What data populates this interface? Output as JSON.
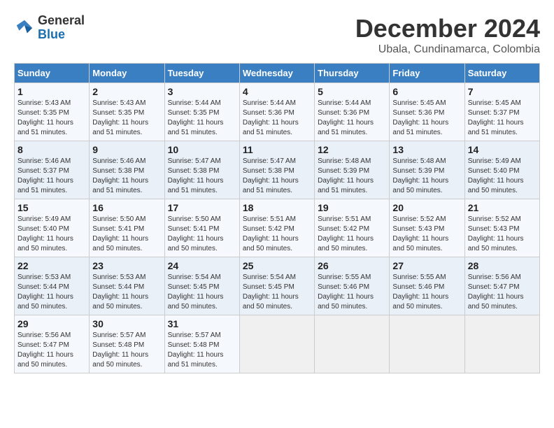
{
  "logo": {
    "line1": "General",
    "line2": "Blue"
  },
  "title": "December 2024",
  "subtitle": "Ubala, Cundinamarca, Colombia",
  "days_header": [
    "Sunday",
    "Monday",
    "Tuesday",
    "Wednesday",
    "Thursday",
    "Friday",
    "Saturday"
  ],
  "weeks": [
    [
      {
        "day": "1",
        "info": "Sunrise: 5:43 AM\nSunset: 5:35 PM\nDaylight: 11 hours\nand 51 minutes."
      },
      {
        "day": "2",
        "info": "Sunrise: 5:43 AM\nSunset: 5:35 PM\nDaylight: 11 hours\nand 51 minutes."
      },
      {
        "day": "3",
        "info": "Sunrise: 5:44 AM\nSunset: 5:35 PM\nDaylight: 11 hours\nand 51 minutes."
      },
      {
        "day": "4",
        "info": "Sunrise: 5:44 AM\nSunset: 5:36 PM\nDaylight: 11 hours\nand 51 minutes."
      },
      {
        "day": "5",
        "info": "Sunrise: 5:44 AM\nSunset: 5:36 PM\nDaylight: 11 hours\nand 51 minutes."
      },
      {
        "day": "6",
        "info": "Sunrise: 5:45 AM\nSunset: 5:36 PM\nDaylight: 11 hours\nand 51 minutes."
      },
      {
        "day": "7",
        "info": "Sunrise: 5:45 AM\nSunset: 5:37 PM\nDaylight: 11 hours\nand 51 minutes."
      }
    ],
    [
      {
        "day": "8",
        "info": "Sunrise: 5:46 AM\nSunset: 5:37 PM\nDaylight: 11 hours\nand 51 minutes."
      },
      {
        "day": "9",
        "info": "Sunrise: 5:46 AM\nSunset: 5:38 PM\nDaylight: 11 hours\nand 51 minutes."
      },
      {
        "day": "10",
        "info": "Sunrise: 5:47 AM\nSunset: 5:38 PM\nDaylight: 11 hours\nand 51 minutes."
      },
      {
        "day": "11",
        "info": "Sunrise: 5:47 AM\nSunset: 5:38 PM\nDaylight: 11 hours\nand 51 minutes."
      },
      {
        "day": "12",
        "info": "Sunrise: 5:48 AM\nSunset: 5:39 PM\nDaylight: 11 hours\nand 51 minutes."
      },
      {
        "day": "13",
        "info": "Sunrise: 5:48 AM\nSunset: 5:39 PM\nDaylight: 11 hours\nand 50 minutes."
      },
      {
        "day": "14",
        "info": "Sunrise: 5:49 AM\nSunset: 5:40 PM\nDaylight: 11 hours\nand 50 minutes."
      }
    ],
    [
      {
        "day": "15",
        "info": "Sunrise: 5:49 AM\nSunset: 5:40 PM\nDaylight: 11 hours\nand 50 minutes."
      },
      {
        "day": "16",
        "info": "Sunrise: 5:50 AM\nSunset: 5:41 PM\nDaylight: 11 hours\nand 50 minutes."
      },
      {
        "day": "17",
        "info": "Sunrise: 5:50 AM\nSunset: 5:41 PM\nDaylight: 11 hours\nand 50 minutes."
      },
      {
        "day": "18",
        "info": "Sunrise: 5:51 AM\nSunset: 5:42 PM\nDaylight: 11 hours\nand 50 minutes."
      },
      {
        "day": "19",
        "info": "Sunrise: 5:51 AM\nSunset: 5:42 PM\nDaylight: 11 hours\nand 50 minutes."
      },
      {
        "day": "20",
        "info": "Sunrise: 5:52 AM\nSunset: 5:43 PM\nDaylight: 11 hours\nand 50 minutes."
      },
      {
        "day": "21",
        "info": "Sunrise: 5:52 AM\nSunset: 5:43 PM\nDaylight: 11 hours\nand 50 minutes."
      }
    ],
    [
      {
        "day": "22",
        "info": "Sunrise: 5:53 AM\nSunset: 5:44 PM\nDaylight: 11 hours\nand 50 minutes."
      },
      {
        "day": "23",
        "info": "Sunrise: 5:53 AM\nSunset: 5:44 PM\nDaylight: 11 hours\nand 50 minutes."
      },
      {
        "day": "24",
        "info": "Sunrise: 5:54 AM\nSunset: 5:45 PM\nDaylight: 11 hours\nand 50 minutes."
      },
      {
        "day": "25",
        "info": "Sunrise: 5:54 AM\nSunset: 5:45 PM\nDaylight: 11 hours\nand 50 minutes."
      },
      {
        "day": "26",
        "info": "Sunrise: 5:55 AM\nSunset: 5:46 PM\nDaylight: 11 hours\nand 50 minutes."
      },
      {
        "day": "27",
        "info": "Sunrise: 5:55 AM\nSunset: 5:46 PM\nDaylight: 11 hours\nand 50 minutes."
      },
      {
        "day": "28",
        "info": "Sunrise: 5:56 AM\nSunset: 5:47 PM\nDaylight: 11 hours\nand 50 minutes."
      }
    ],
    [
      {
        "day": "29",
        "info": "Sunrise: 5:56 AM\nSunset: 5:47 PM\nDaylight: 11 hours\nand 50 minutes."
      },
      {
        "day": "30",
        "info": "Sunrise: 5:57 AM\nSunset: 5:48 PM\nDaylight: 11 hours\nand 50 minutes."
      },
      {
        "day": "31",
        "info": "Sunrise: 5:57 AM\nSunset: 5:48 PM\nDaylight: 11 hours\nand 51 minutes."
      },
      {
        "day": "",
        "info": ""
      },
      {
        "day": "",
        "info": ""
      },
      {
        "day": "",
        "info": ""
      },
      {
        "day": "",
        "info": ""
      }
    ]
  ]
}
